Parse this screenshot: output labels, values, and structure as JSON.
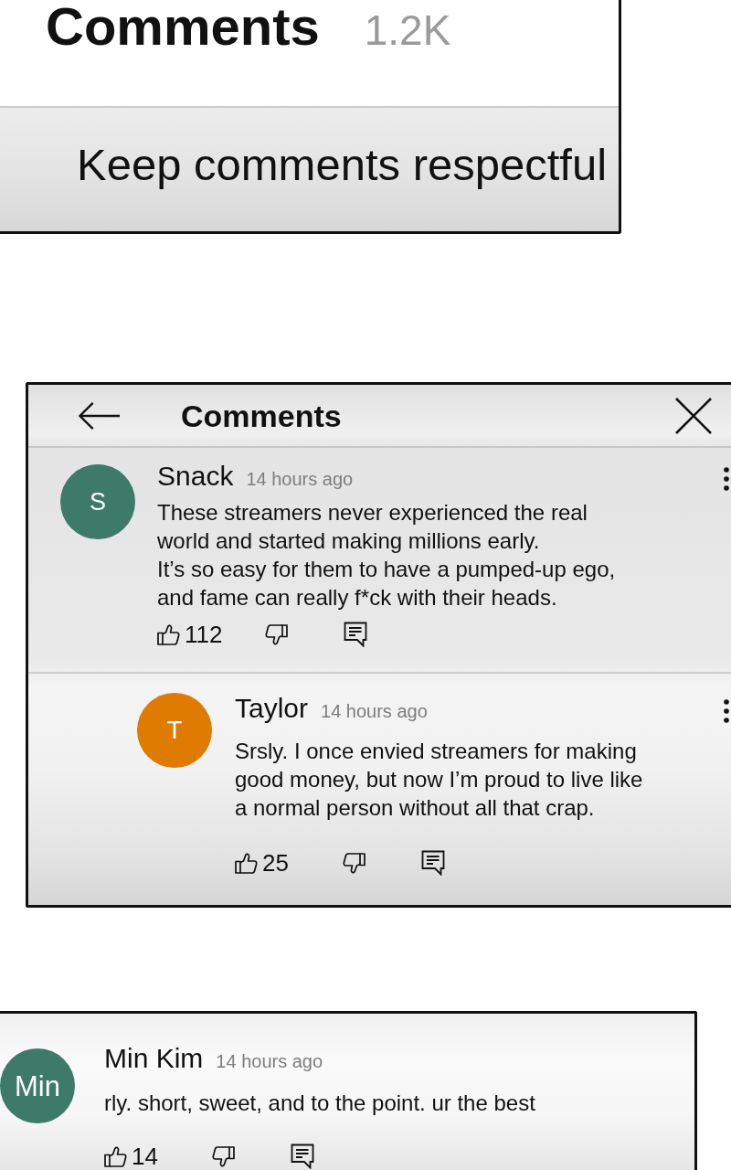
{
  "panels": [
    {
      "kind": "title_card",
      "title": "Comments",
      "count": "1.2K",
      "notice": "Keep comments respectful"
    },
    {
      "kind": "sheet",
      "title": "Comments",
      "comments": [
        {
          "author": "Snack",
          "initial": "S",
          "color": "#3d7a67",
          "time": "14 hours ago",
          "text": "These streamers never experienced the real\nworld and started making millions early.\nIt’s so easy for them to have a pumped-up ego,\nand fame can really f*ck with their heads.",
          "likes": "112",
          "replies": [
            {
              "author": "Taylor",
              "initial": "T",
              "color": "#df7b00",
              "time": "14 hours ago",
              "text": "Srsly. I once envied streamers for making\ngood money, but now I’m proud to live like\na normal person without all that crap.",
              "likes": "25"
            }
          ]
        }
      ]
    },
    {
      "kind": "card",
      "comments": [
        {
          "author": "Min Kim",
          "initial": "Min",
          "color": "#3d7a67",
          "time": "14 hours ago",
          "text": "rly. short, sweet, and to the point. ur the best",
          "likes": "14"
        }
      ]
    }
  ]
}
